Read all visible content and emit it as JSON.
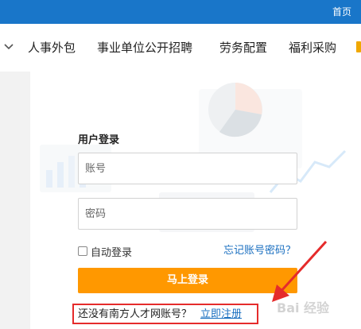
{
  "topbar": {
    "home_label": "首页",
    "color": "#1976c9"
  },
  "nav": {
    "items": [
      "人事外包",
      "事业单位公开招聘",
      "劳务配置",
      "福利采购"
    ]
  },
  "login": {
    "title": "用户登录",
    "account_placeholder": "账号",
    "password_placeholder": "密码",
    "remember_label": "自动登录",
    "forgot_label": "忘记账号密码？",
    "submit_label": "马上登录",
    "submit_color": "#ff9800"
  },
  "register": {
    "prompt": "还没有南方人才网账号？",
    "link_label": "立即注册",
    "highlight_color": "#e52b2b"
  },
  "watermark": {
    "text": "Bai 经验"
  }
}
